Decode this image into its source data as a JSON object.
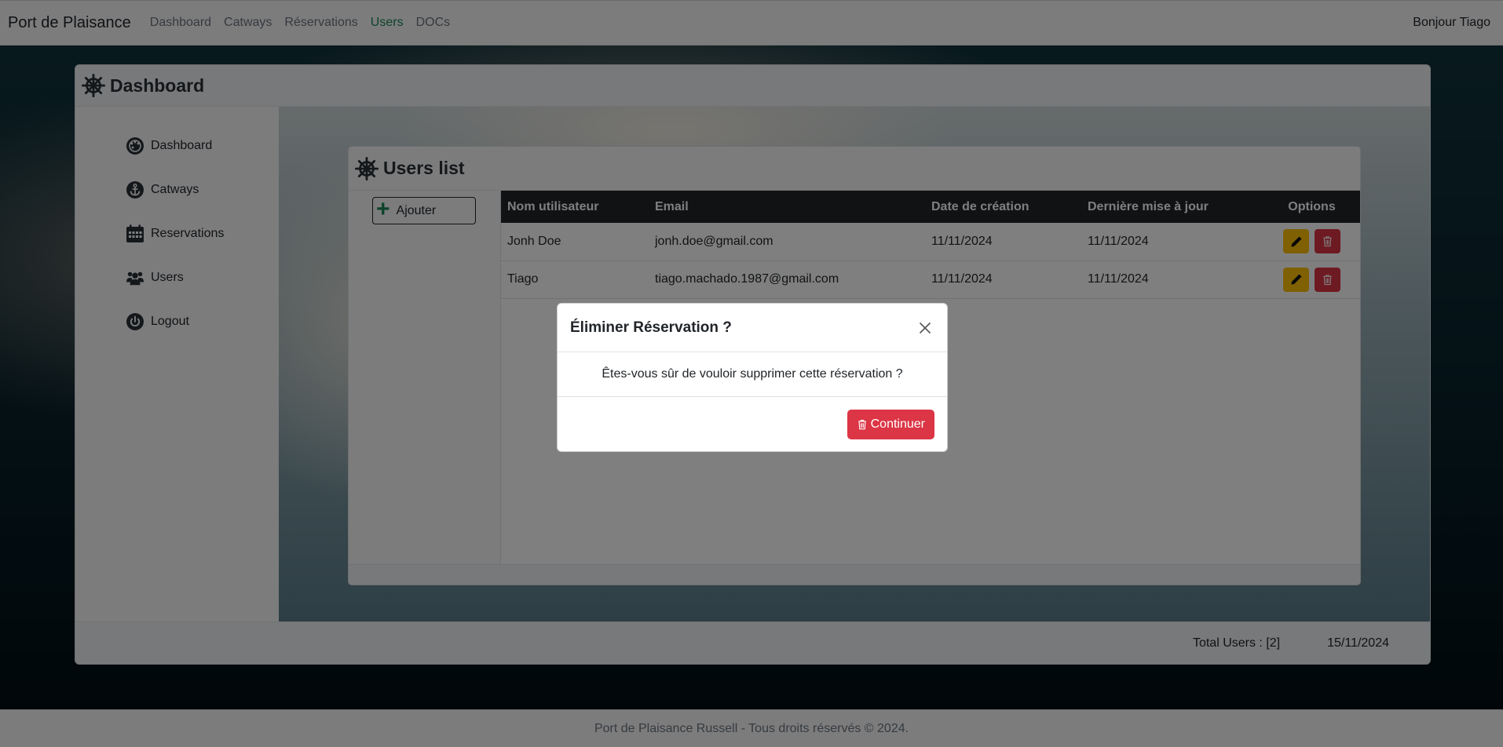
{
  "navbar": {
    "brand": "Port de Plaisance",
    "links": [
      {
        "label": "Dashboard",
        "active": false
      },
      {
        "label": "Catways",
        "active": false
      },
      {
        "label": "Réservations",
        "active": false
      },
      {
        "label": "Users",
        "active": true
      },
      {
        "label": "DOCs",
        "active": false
      }
    ],
    "greeting": "Bonjour Tiago"
  },
  "dashboard": {
    "title": "Dashboard",
    "sidebar": [
      {
        "label": "Dashboard",
        "icon": "palette-icon"
      },
      {
        "label": "Catways",
        "icon": "anchor-icon"
      },
      {
        "label": "Reservations",
        "icon": "calendar-icon"
      },
      {
        "label": "Users",
        "icon": "users-icon"
      },
      {
        "label": "Logout",
        "icon": "power-icon"
      }
    ],
    "footer": {
      "total_users": "Total Users : [2]",
      "date": "15/11/2024"
    }
  },
  "users": {
    "title": "Users list",
    "add_label": "Ajouter",
    "columns": [
      "Nom utilisateur",
      "Email",
      "Date de création",
      "Dernière mise à jour",
      "Options"
    ],
    "rows": [
      {
        "name": "Jonh Doe",
        "email": "jonh.doe@gmail.com",
        "created": "11/11/2024",
        "updated": "11/11/2024"
      },
      {
        "name": "Tiago",
        "email": "tiago.machado.1987@gmail.com",
        "created": "11/11/2024",
        "updated": "11/11/2024"
      }
    ]
  },
  "modal": {
    "title": "Éliminer Réservation ?",
    "body": "Êtes-vous sûr de vouloir supprimer cette réservation ?",
    "continue_label": "Continuer"
  },
  "page_footer": "Port de Plaisance Russell - Tous droits réservés © 2024.",
  "colors": {
    "primary_dark": "#212529",
    "danger": "#dc3545",
    "warning": "#ffc107",
    "success": "#198754"
  }
}
